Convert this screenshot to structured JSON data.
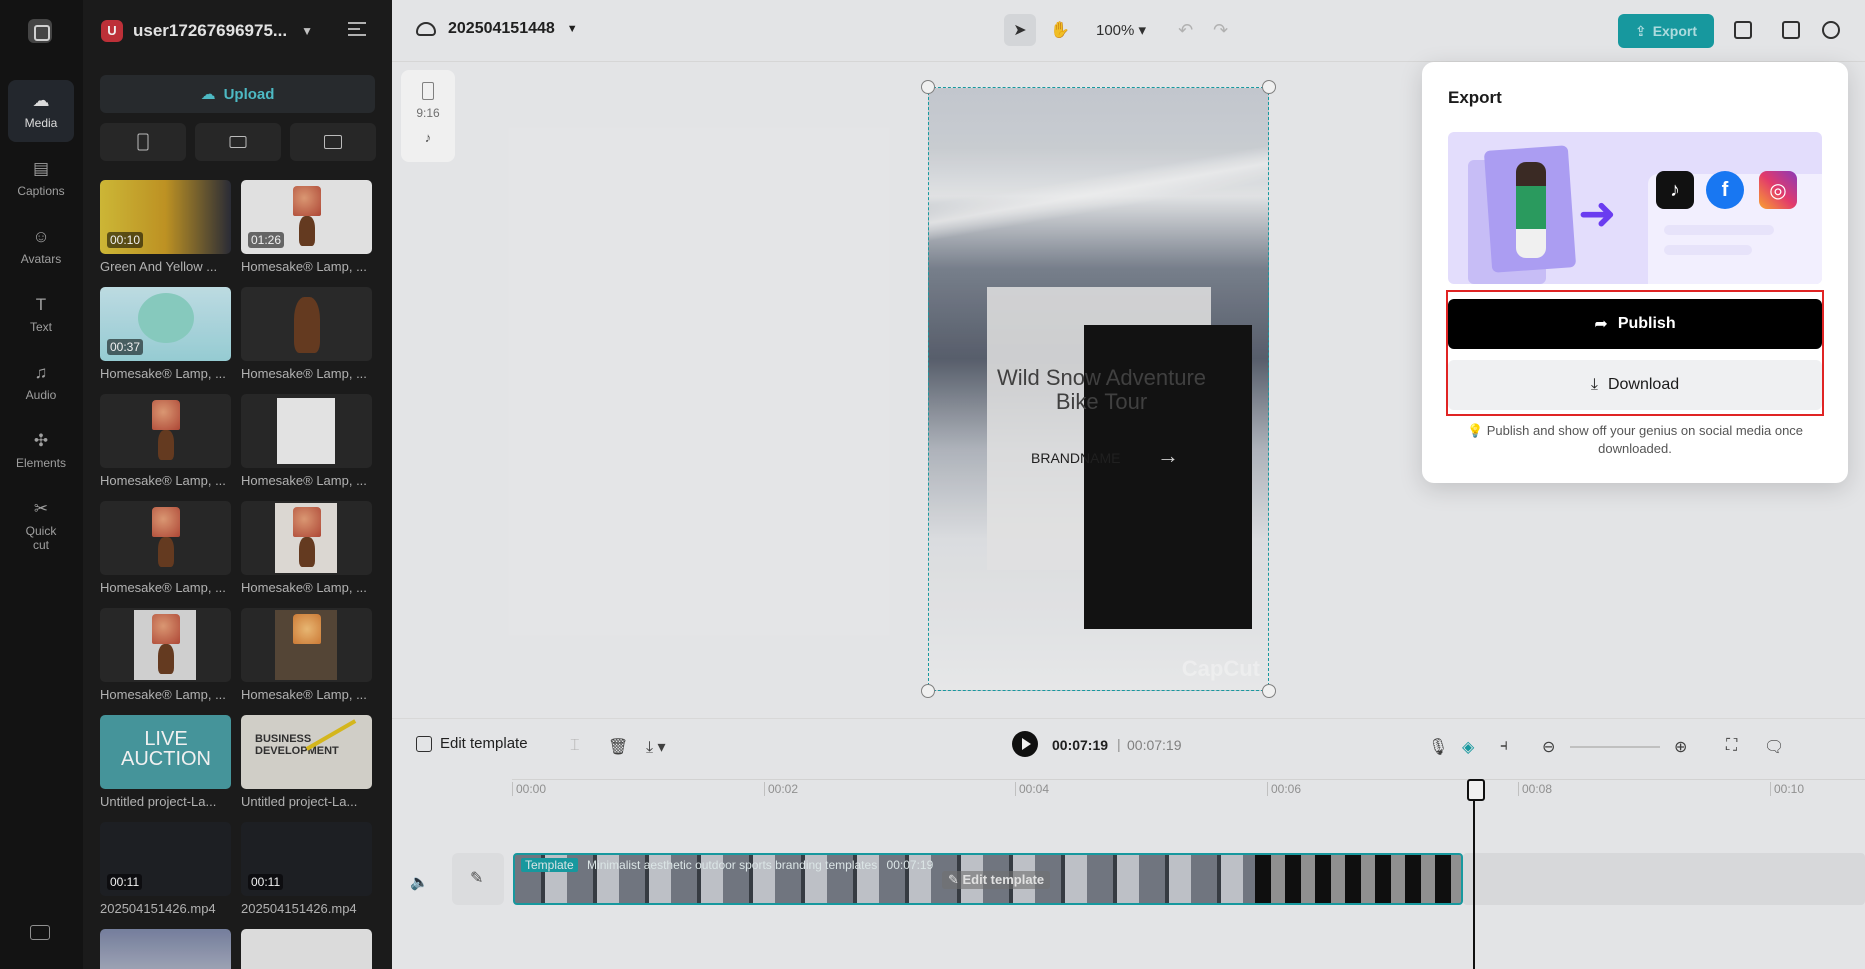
{
  "rail": {
    "items": [
      {
        "label": "Media",
        "icon": "cloud-upload-icon"
      },
      {
        "label": "Captions",
        "icon": "captions-icon"
      },
      {
        "label": "Avatars",
        "icon": "avatar-icon"
      },
      {
        "label": "Text",
        "icon": "text-icon"
      },
      {
        "label": "Audio",
        "icon": "music-note-icon"
      },
      {
        "label": "Elements",
        "icon": "elements-icon"
      },
      {
        "label": "Quick",
        "label2": "cut",
        "icon": "scissors-icon"
      }
    ]
  },
  "panel": {
    "user_initial": "U",
    "username": "user17267696975...",
    "upload_label": "Upload",
    "media": [
      {
        "caption": "Green And Yellow ...",
        "duration": "00:10"
      },
      {
        "caption": "Homesake® Lamp, ...",
        "duration": "01:26"
      },
      {
        "caption": "Homesake® Lamp, ...",
        "duration": "00:37"
      },
      {
        "caption": "Homesake® Lamp, ...",
        "duration": ""
      },
      {
        "caption": "Homesake® Lamp, ...",
        "duration": ""
      },
      {
        "caption": "Homesake® Lamp, ...",
        "duration": ""
      },
      {
        "caption": "Homesake® Lamp, ...",
        "duration": ""
      },
      {
        "caption": "Homesake® Lamp, ...",
        "duration": ""
      },
      {
        "caption": "Homesake® Lamp, ...",
        "duration": ""
      },
      {
        "caption": "Homesake® Lamp, ...",
        "duration": ""
      },
      {
        "caption": "Untitled project-La...",
        "duration": "",
        "overlay": "LIVE AUCTION"
      },
      {
        "caption": "Untitled project-La...",
        "duration": "",
        "overlay": "BUSINESS DEVELOPMENT"
      },
      {
        "caption": "202504151426.mp4",
        "duration": "00:11"
      },
      {
        "caption": "202504151426.mp4",
        "duration": "00:11"
      }
    ]
  },
  "topbar": {
    "project_name": "202504151448",
    "zoom": "100%",
    "export_label": "Export"
  },
  "canvas": {
    "ratio": "9:16",
    "title_line1": "Wild Snow Adventure",
    "title_line2": "Bike Tour",
    "brand": "BRANDNAME",
    "watermark": "CapCut"
  },
  "timeline": {
    "edit_template": "Edit template",
    "current_time": "00:07:19",
    "total_time": "00:07:19",
    "ticks": [
      "00:00",
      "00:02",
      "00:04",
      "00:06",
      "00:08",
      "00:10"
    ],
    "clip_tag": "Template",
    "clip_title": "Minimalist aesthetic outdoor sports branding templates",
    "clip_duration": "00:07:19",
    "clip_edit": "Edit template"
  },
  "export_popup": {
    "title": "Export",
    "publish_label": "Publish",
    "download_label": "Download",
    "hint": "Publish and show off your genius on social media once downloaded.",
    "colors": {
      "accent": "#19a2a8",
      "highlight": "#e02424"
    }
  }
}
